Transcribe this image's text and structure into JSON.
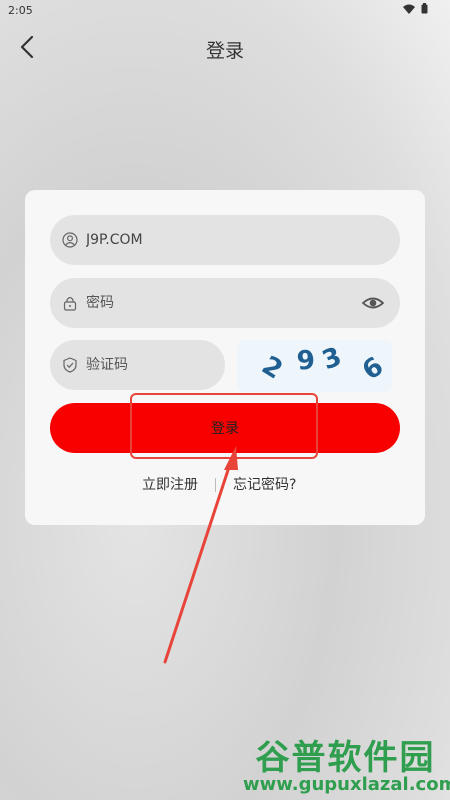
{
  "status_bar": {
    "time": "2:05",
    "icons": [
      "wifi-icon",
      "battery-icon"
    ]
  },
  "header": {
    "title": "登录",
    "back_icon": "chevron-left-icon"
  },
  "form": {
    "username": {
      "value": "J9P.COM",
      "icon": "user-icon"
    },
    "password": {
      "placeholder": "密码",
      "icon": "lock-icon",
      "toggle_icon": "eye-icon"
    },
    "captcha_input": {
      "placeholder": "验证码",
      "icon": "shield-icon"
    },
    "captcha_image": {
      "d1": "2",
      "d2": "9",
      "d3": "3",
      "d4": "6"
    },
    "login_button": "登录",
    "register_link": "立即注册",
    "separator": "|",
    "forgot_link": "忘记密码?"
  },
  "watermark": {
    "line1": "谷普软件园",
    "line2": "www.gupuxlazal.com"
  },
  "colors": {
    "primary": "#f80000",
    "annotation": "#e8443a",
    "captcha_text": "#1f5f91",
    "watermark": "#2f9e4e"
  }
}
